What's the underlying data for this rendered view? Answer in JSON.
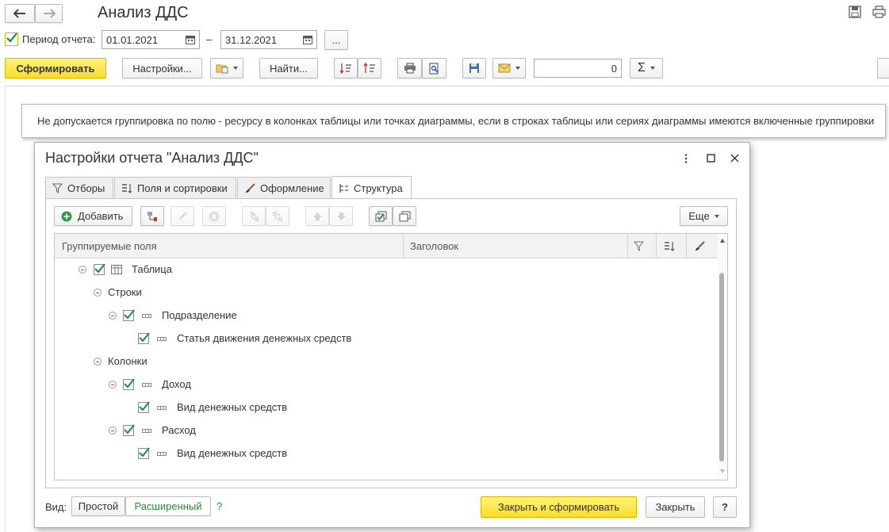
{
  "window": {
    "title": "Анализ ДДС"
  },
  "period": {
    "label": "Период отчета:",
    "from": "01.01.2021",
    "dash": "–",
    "to": "31.12.2021",
    "more": "..."
  },
  "toolbar": {
    "generate": "Сформировать",
    "settings": "Настройки...",
    "find": "Найти...",
    "sum_value": "0"
  },
  "message": "Не допускается группировка по полю - ресурсу в колонках таблицы или точках диаграммы, если в строках таблицы или сериях диаграммы имеются включенные группировки",
  "dialog": {
    "title": "Настройки отчета \"Анализ ДДС\"",
    "tabs": [
      {
        "label": "Отборы"
      },
      {
        "label": "Поля и сортировки"
      },
      {
        "label": "Оформление"
      },
      {
        "label": "Структура"
      }
    ],
    "add": "Добавить",
    "more": "Еще",
    "columns": {
      "fields": "Группируемые поля",
      "header": "Заголовок"
    },
    "tree": [
      {
        "label": "Таблица"
      },
      {
        "label": "Строки"
      },
      {
        "label": "Подразделение"
      },
      {
        "label": "Статья движения денежных средств"
      },
      {
        "label": "Колонки"
      },
      {
        "label": "Доход"
      },
      {
        "label": "Вид денежных средств"
      },
      {
        "label": "Расход"
      },
      {
        "label": "Вид денежных средств"
      }
    ],
    "view_label": "Вид:",
    "view_simple": "Простой",
    "view_extended": "Расширенный",
    "help": "?",
    "close_generate": "Закрыть и сформировать",
    "close": "Закрыть"
  },
  "colors": {
    "accent": "#fbdd2c",
    "check": "#1f8a3b",
    "link": "#2a8a3e"
  }
}
